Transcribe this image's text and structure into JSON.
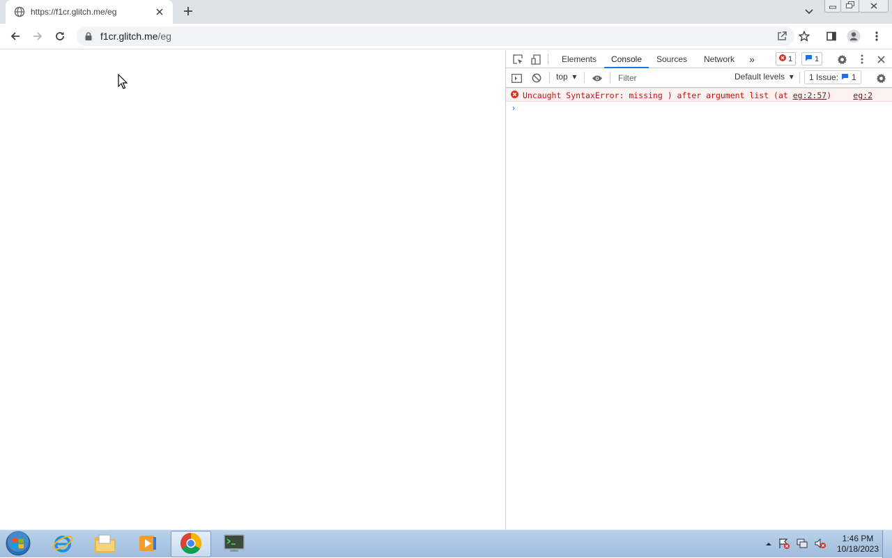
{
  "browser": {
    "tab": {
      "title": "https://f1cr.glitch.me/eg",
      "favicon": "globe-icon",
      "close_icon": "close-icon"
    },
    "new_tab_icon": "plus-icon",
    "window_controls": [
      "minimize-icon",
      "restore-icon",
      "close-icon"
    ],
    "omnibox": {
      "host": "f1cr.glitch.me",
      "path": "/eg",
      "lock_icon": "lock-icon"
    },
    "nav_icons": [
      "back-icon",
      "forward-icon",
      "reload-icon"
    ],
    "right_icons": [
      "share-icon",
      "bookmark-star-icon",
      "side-panel-icon",
      "profile-icon",
      "kebab-menu-icon"
    ]
  },
  "devtools": {
    "tabs": [
      "Elements",
      "Console",
      "Sources",
      "Network"
    ],
    "active_tab": "Console",
    "more_tabs_label": "»",
    "error_count": "1",
    "message_count": "1",
    "console_toolbar": {
      "context": "top",
      "filter_placeholder": "Filter",
      "levels": "Default levels",
      "issues_label": "1 Issue:",
      "issues_count": "1"
    },
    "error": {
      "message_prefix": "Uncaught SyntaxError: missing ) after argument list (at ",
      "message_link": "eg:2:57",
      "message_suffix": ")",
      "source": "eg:2"
    },
    "prompt": "›"
  },
  "taskbar": {
    "apps": [
      "internet-explorer-icon",
      "file-explorer-icon",
      "media-player-icon",
      "chrome-icon",
      "terminal-icon"
    ],
    "active_app": "chrome-icon",
    "clock": {
      "time": "1:46 PM",
      "date": "10/18/2023"
    }
  },
  "colors": {
    "tab_strip": "#dee1e6",
    "error_text": "#c80f0f",
    "error_bg": "#fdf2f2",
    "accent": "#1a73e8"
  }
}
